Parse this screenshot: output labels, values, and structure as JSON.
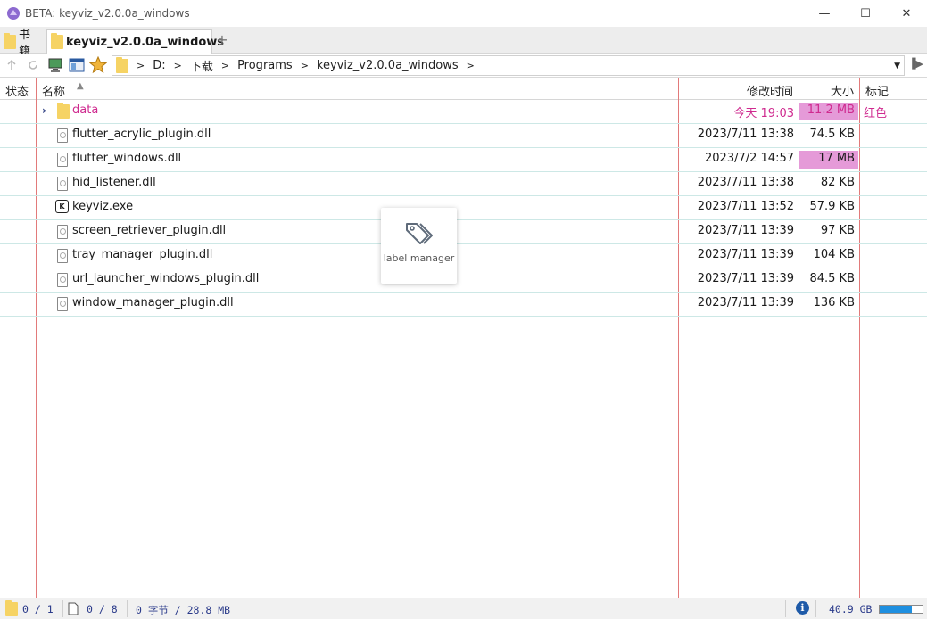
{
  "window": {
    "title": "BETA: keyviz_v2.0.0a_windows",
    "minimize_glyph": "—",
    "maximize_glyph": "☐",
    "close_glyph": "✕"
  },
  "tabs": [
    {
      "label": "书籍",
      "active": false
    },
    {
      "label": "keyviz_v2.0.0a_windows",
      "active": true
    }
  ],
  "tab_add_label": "+",
  "address": {
    "crumbs": [
      "D:",
      "下载",
      "Programs",
      "keyviz_v2.0.0a_windows"
    ]
  },
  "columns": {
    "status": "状态",
    "name": "名称",
    "modified": "修改时间",
    "size": "大小",
    "tag": "标记"
  },
  "files": [
    {
      "name": "data",
      "date": "今天  19:03",
      "size": "11.2 MB",
      "tag": "红色",
      "type": "folder",
      "highlight_size": true,
      "red": true
    },
    {
      "name": "flutter_acrylic_plugin.dll",
      "date": "2023/7/11  13:38",
      "size": "74.5 KB",
      "tag": "",
      "type": "dll",
      "highlight_size": false,
      "red": false
    },
    {
      "name": "flutter_windows.dll",
      "date": "2023/7/2  14:57",
      "size": "17 MB",
      "tag": "",
      "type": "dll",
      "highlight_size": true,
      "red": false
    },
    {
      "name": "hid_listener.dll",
      "date": "2023/7/11  13:38",
      "size": "82 KB",
      "tag": "",
      "type": "dll",
      "highlight_size": false,
      "red": false
    },
    {
      "name": "keyviz.exe",
      "date": "2023/7/11  13:52",
      "size": "57.9 KB",
      "tag": "",
      "type": "exe",
      "highlight_size": false,
      "red": false
    },
    {
      "name": "screen_retriever_plugin.dll",
      "date": "2023/7/11  13:39",
      "size": "97 KB",
      "tag": "",
      "type": "dll",
      "highlight_size": false,
      "red": false
    },
    {
      "name": "tray_manager_plugin.dll",
      "date": "2023/7/11  13:39",
      "size": "104 KB",
      "tag": "",
      "type": "dll",
      "highlight_size": false,
      "red": false
    },
    {
      "name": "url_launcher_windows_plugin.dll",
      "date": "2023/7/11  13:39",
      "size": "84.5 KB",
      "tag": "",
      "type": "dll",
      "highlight_size": false,
      "red": false
    },
    {
      "name": "window_manager_plugin.dll",
      "date": "2023/7/11  13:39",
      "size": "136 KB",
      "tag": "",
      "type": "dll",
      "highlight_size": false,
      "red": false
    }
  ],
  "label_manager": {
    "label": "label manager"
  },
  "status": {
    "folders": "0 / 1",
    "files": "0 / 8",
    "bytes": "0 字节 / 28.8 MB",
    "info_glyph": "i",
    "free_space": "40.9 GB",
    "disk_used_fraction": 0.75
  },
  "colors": {
    "tag_red": "#cf2a8f",
    "size_highlight": "#e59ad8",
    "column_line": "#e27a7a",
    "row_border": "#cde8e6"
  }
}
